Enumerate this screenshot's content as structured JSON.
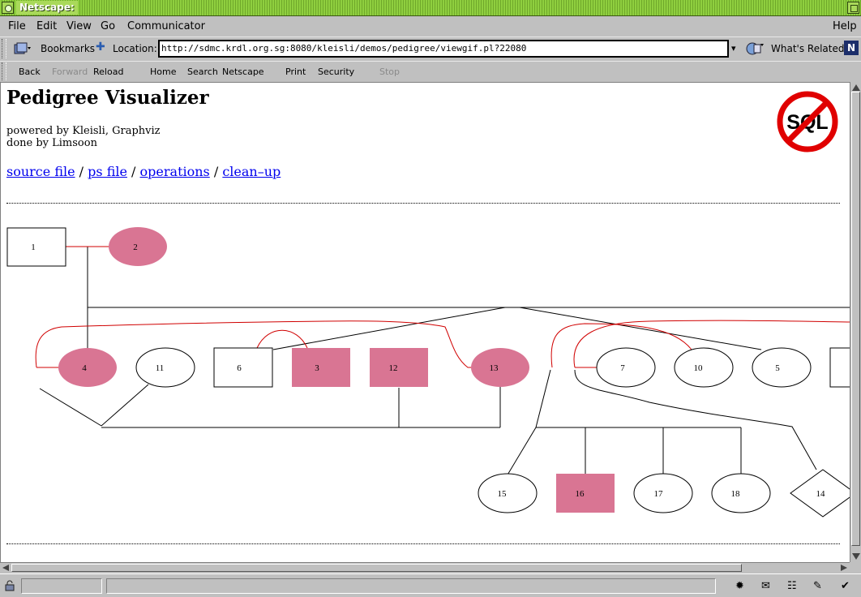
{
  "window": {
    "title": "Netscape:"
  },
  "menu": {
    "file": "File",
    "edit": "Edit",
    "view": "View",
    "go": "Go",
    "communicator": "Communicator",
    "help": "Help"
  },
  "location_bar": {
    "bookmarks_label": "Bookmarks",
    "location_label": "Location:",
    "url": "http://sdmc.krdl.org.sg:8080/kleisli/demos/pedigree/viewgif.pl?22080",
    "whats_related_label": "What's Related",
    "brand_letter": "N"
  },
  "nav_toolbar": {
    "back": "Back",
    "forward": "Forward",
    "reload": "Reload",
    "home": "Home",
    "search": "Search",
    "netscape": "Netscape",
    "print": "Print",
    "security": "Security",
    "stop": "Stop"
  },
  "page": {
    "title": "Pedigree Visualizer",
    "powered_by": "powered by Kleisli, Graphviz",
    "done_by": "done by Limsoon",
    "logo_text": "SQL",
    "links": {
      "source_file": "source file",
      "ps_file": "ps file",
      "operations": "operations",
      "clean_up": "clean–up",
      "separator": "/"
    }
  },
  "pedigree": {
    "colors": {
      "affected_fill": "#d97593",
      "line": "#000000",
      "marriage_line": "#d00000"
    },
    "nodes": [
      {
        "id": "1",
        "shape": "box",
        "affected": false
      },
      {
        "id": "2",
        "shape": "ellipse",
        "affected": true
      },
      {
        "id": "4",
        "shape": "ellipse",
        "affected": true
      },
      {
        "id": "11",
        "shape": "ellipse",
        "affected": false
      },
      {
        "id": "6",
        "shape": "box",
        "affected": false
      },
      {
        "id": "3",
        "shape": "box",
        "affected": true
      },
      {
        "id": "12",
        "shape": "box",
        "affected": true
      },
      {
        "id": "13",
        "shape": "ellipse",
        "affected": true
      },
      {
        "id": "7",
        "shape": "ellipse",
        "affected": false
      },
      {
        "id": "10",
        "shape": "ellipse",
        "affected": false
      },
      {
        "id": "5",
        "shape": "ellipse",
        "affected": false
      },
      {
        "id": "15",
        "shape": "ellipse",
        "affected": false
      },
      {
        "id": "16",
        "shape": "box",
        "affected": true
      },
      {
        "id": "17",
        "shape": "ellipse",
        "affected": false
      },
      {
        "id": "18",
        "shape": "ellipse",
        "affected": false
      },
      {
        "id": "14",
        "shape": "diamond",
        "affected": false
      }
    ]
  }
}
